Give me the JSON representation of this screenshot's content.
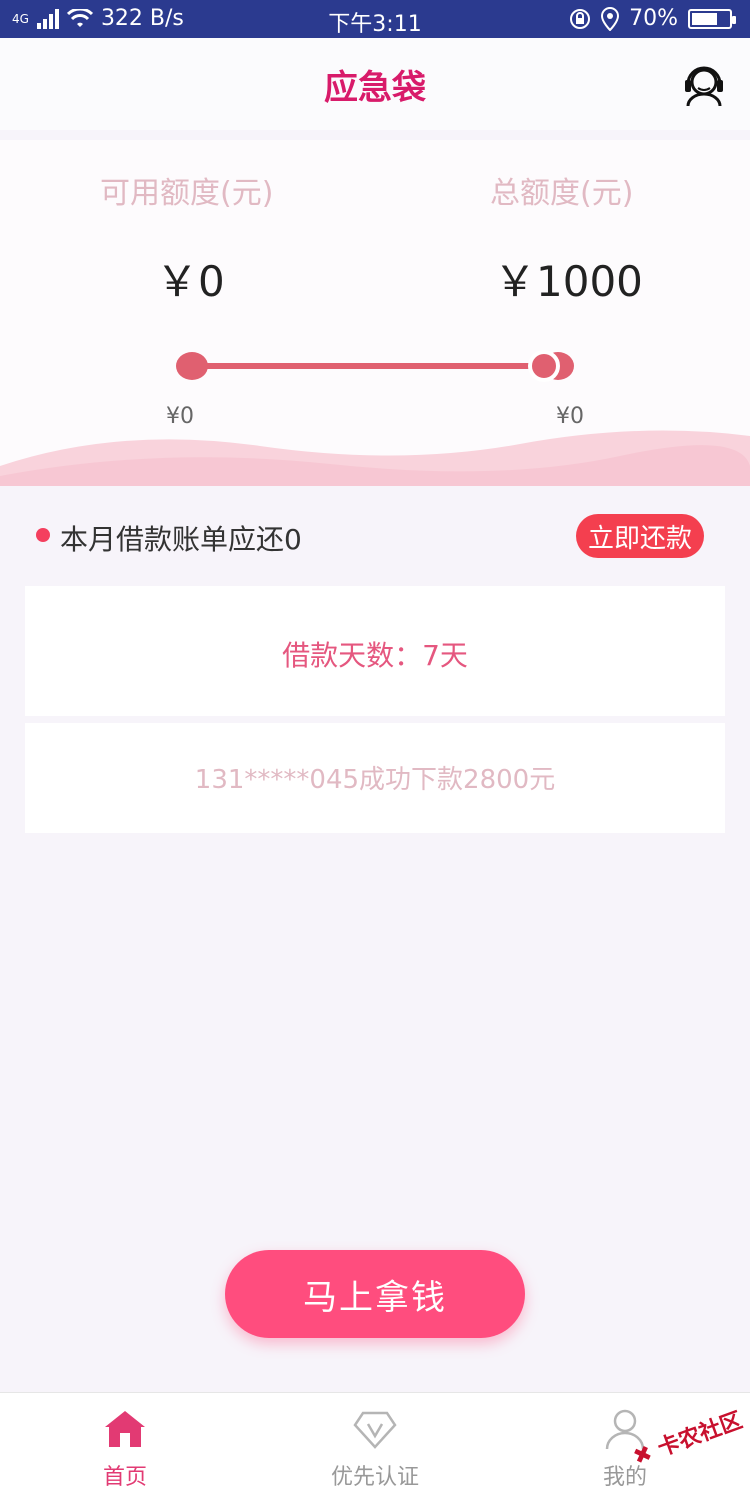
{
  "status_bar": {
    "network": "4G",
    "speed": "322 B/s",
    "time": "下午3:11",
    "battery": "70%",
    "battery_level": 0.7
  },
  "header": {
    "title": "应急袋"
  },
  "quota": {
    "available_label": "可用额度(元)",
    "available_value": "￥0",
    "total_label": "总额度(元)",
    "total_value": "￥1000",
    "slider_min": "¥0",
    "slider_max": "¥0"
  },
  "bill": {
    "text": "本月借款账单应还0",
    "repay_label": "立即还款"
  },
  "loan_days": "借款天数：7天",
  "notice": "131*****045成功下款2800元",
  "get_money_label": "马上拿钱",
  "tabs": [
    {
      "label": "首页",
      "icon": "home-icon",
      "active": true
    },
    {
      "label": "优先认证",
      "icon": "vip-diamond-icon",
      "active": false
    },
    {
      "label": "我的",
      "icon": "user-icon",
      "active": false
    }
  ],
  "watermark": "卡农社区",
  "colors": {
    "accent": "#ff4d7e",
    "title": "#d81b6a",
    "repay": "#f43f4f",
    "status_bar": "#2b3a8f"
  }
}
